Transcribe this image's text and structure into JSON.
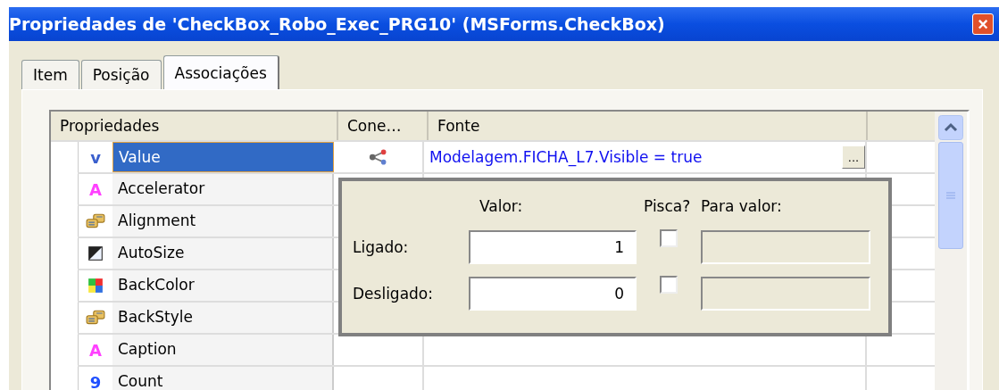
{
  "window": {
    "title": "Propriedades de 'CheckBox_Robo_Exec_PRG10' (MSForms.CheckBox)",
    "close": "×"
  },
  "tabs": [
    {
      "label": "Item",
      "selected": false
    },
    {
      "label": "Posição",
      "selected": false
    },
    {
      "label": "Associações",
      "selected": true
    }
  ],
  "table": {
    "columns": [
      "Propriedades",
      "Cone…",
      "Fonte"
    ],
    "rows": [
      {
        "name": "Value",
        "kind": "value",
        "glyph": "v",
        "selected": true,
        "connection": true,
        "source": "Modelagem.FICHA_L7.Visible = true",
        "browse": "..."
      },
      {
        "name": "Accelerator",
        "kind": "text",
        "glyph": "A",
        "selected": false
      },
      {
        "name": "Alignment",
        "kind": "enum",
        "selected": false
      },
      {
        "name": "AutoSize",
        "kind": "bool",
        "selected": false
      },
      {
        "name": "BackColor",
        "kind": "color",
        "selected": false
      },
      {
        "name": "BackStyle",
        "kind": "enum",
        "selected": false
      },
      {
        "name": "Caption",
        "kind": "text",
        "glyph": "A",
        "selected": false
      },
      {
        "name": "Count",
        "kind": "number",
        "glyph": "9",
        "selected": false
      }
    ]
  },
  "popup": {
    "headers": [
      "Valor:",
      "Pisca?",
      "Para valor:"
    ],
    "rows": [
      {
        "label": "Ligado:",
        "value": "1",
        "checked": false,
        "disabled": true
      },
      {
        "label": "Desligado:",
        "value": "0",
        "checked": false,
        "disabled": true
      }
    ]
  }
}
